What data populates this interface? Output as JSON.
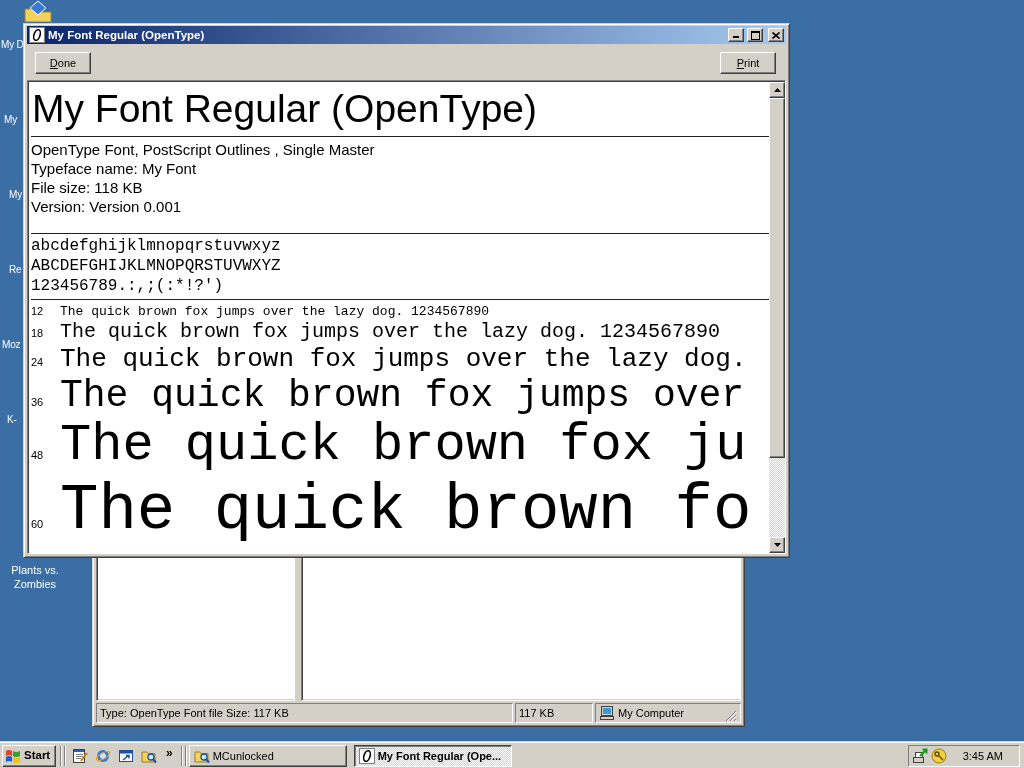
{
  "desktop_icons": [
    {
      "label": "My D"
    },
    {
      "label": "My"
    },
    {
      "label": "My"
    },
    {
      "label": "Re"
    },
    {
      "label": "Moz"
    },
    {
      "label": "K-"
    },
    {
      "label": "Plants vs. Zombies"
    }
  ],
  "font_viewer": {
    "title": "My Font Regular (OpenType)",
    "buttons": [
      "Done",
      "Print"
    ],
    "heading": "My Font Regular (OpenType)",
    "info": [
      "OpenType Font, PostScript Outlines , Single Master",
      "Typeface name: My Font",
      "File size: 118 KB",
      "Version: Version 0.001"
    ],
    "character_set": [
      "abcdefghijklmnopqrstuvwxyz",
      "ABCDEFGHIJKLMNOPQRSTUVWXYZ",
      "123456789.:,;(:*!?')"
    ],
    "samples": [
      {
        "size": "12",
        "text": "The quick brown fox jumps over the lazy dog. 1234567890"
      },
      {
        "size": "18",
        "text": "The quick brown fox jumps over the lazy dog. 1234567890"
      },
      {
        "size": "24",
        "text": "The quick brown fox jumps over the lazy dog."
      },
      {
        "size": "36",
        "text": "The quick brown fox jumps over"
      },
      {
        "size": "48",
        "text": "The quick brown fox ju"
      },
      {
        "size": "60",
        "text": "The quick brown fo"
      }
    ]
  },
  "explorer_window": {
    "status_bar": [
      "Type: OpenType Font file Size: 117 KB",
      "117 KB",
      "My Computer"
    ]
  },
  "taskbar": {
    "start": "Start",
    "more": "»",
    "tasks": [
      {
        "label": "MCunlocked",
        "selected": false
      },
      {
        "label": "My Font Regular (Ope...",
        "selected": true
      }
    ],
    "clock": "3:45 AM"
  }
}
